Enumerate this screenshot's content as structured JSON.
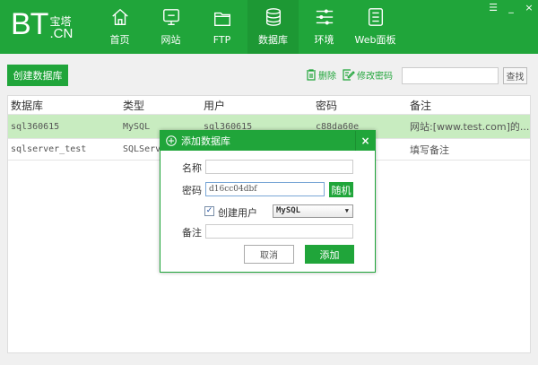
{
  "logo": {
    "main": "BT",
    "top": "宝塔",
    "bottom": ".CN"
  },
  "nav": [
    {
      "label": "首页",
      "icon": "home-icon"
    },
    {
      "label": "网站",
      "icon": "monitor-icon"
    },
    {
      "label": "FTP",
      "icon": "folder-icon"
    },
    {
      "label": "数据库",
      "icon": "database-icon",
      "active": true
    },
    {
      "label": "环境",
      "icon": "sliders-icon"
    },
    {
      "label": "Web面板",
      "icon": "list-icon"
    }
  ],
  "window": {
    "menu": "☰",
    "minimize": "_",
    "close": "×"
  },
  "toolbar": {
    "create": "创建数据库",
    "delete": "删除",
    "change_password": "修改密码",
    "search_placeholder": "",
    "search_button": "查找"
  },
  "table": {
    "headers": [
      "数据库",
      "类型",
      "用户",
      "密码",
      "备注"
    ],
    "rows": [
      [
        "sql360615",
        "MySQL",
        "sql360615",
        "c88da60e",
        "网站:[www.test.com]的..."
      ],
      [
        "sqlserver_test",
        "SQLServer",
        "",
        "",
        "填写备注"
      ]
    ]
  },
  "dialog": {
    "title": "添加数据库",
    "close": "×",
    "name_label": "名称",
    "name_value": "",
    "password_label": "密码",
    "password_value": "d16cc04dbf",
    "random_button": "随机",
    "create_user_label": "创建用户",
    "create_user_checked": true,
    "db_type": "MySQL",
    "note_label": "备注",
    "note_value": "",
    "cancel": "取消",
    "submit": "添加"
  },
  "colors": {
    "brand": "#20a53a",
    "selected_row": "#c8ecc0"
  }
}
